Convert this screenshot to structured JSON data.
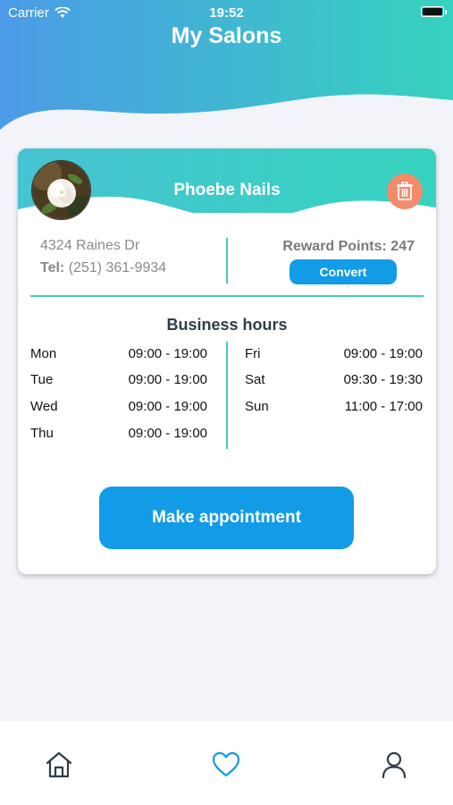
{
  "status_bar": {
    "carrier": "Carrier",
    "time": "19:52"
  },
  "header": {
    "title": "My Salons"
  },
  "salon": {
    "name": "Phoebe Nails",
    "address": "4324 Raines Dr",
    "tel_label": "Tel:",
    "tel_value": "(251) 361-9934",
    "reward_text": "Reward Points: 247",
    "convert_label": "Convert",
    "hours_title": "Business hours",
    "hours_left": [
      {
        "day": "Mon",
        "time": "09:00 - 19:00"
      },
      {
        "day": "Tue",
        "time": "09:00 - 19:00"
      },
      {
        "day": "Wed",
        "time": "09:00 - 19:00"
      },
      {
        "day": "Thu",
        "time": "09:00 - 19:00"
      }
    ],
    "hours_right": [
      {
        "day": "Fri",
        "time": "09:00 - 19:00"
      },
      {
        "day": "Sat",
        "time": "09:30 - 19:30"
      },
      {
        "day": "Sun",
        "time": "11:00 - 17:00"
      }
    ],
    "make_appointment_label": "Make appointment"
  },
  "tabbar": {
    "items": [
      {
        "icon": "home-icon",
        "active": false
      },
      {
        "icon": "heart-icon",
        "active": true
      },
      {
        "icon": "user-icon",
        "active": false
      }
    ]
  },
  "colors": {
    "accent_blue": "#129be6",
    "teal": "#36cfc0",
    "delete_orange": "#f48b6b",
    "background": "#f3f3fa"
  }
}
